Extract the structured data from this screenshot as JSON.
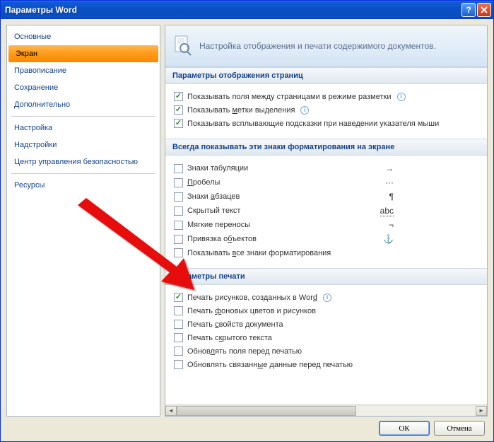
{
  "window": {
    "title": "Параметры Word"
  },
  "sidebar": {
    "items": [
      "Основные",
      "Экран",
      "Правописание",
      "Сохранение",
      "Дополнительно",
      "Настройка",
      "Надстройки",
      "Центр управления безопасностью",
      "Ресурсы"
    ],
    "selected_index": 1
  },
  "header": {
    "text": "Настройка отображения и печати содержимого документов."
  },
  "sections": {
    "display": {
      "title": "Параметры отображения страниц",
      "options": [
        {
          "label_html": "Показывать поля между страницами в режиме разметки",
          "checked": true,
          "info": true
        },
        {
          "label_html": "Показывать <u>м</u>етки выделения",
          "checked": true,
          "info": true
        },
        {
          "label_html": "Показывать всплывающие подсказки при наведении указателя мыши",
          "checked": true,
          "info": false
        }
      ]
    },
    "marks": {
      "title": "Всегда показывать эти знаки форматирования на экране",
      "options": [
        {
          "label_html": "Знаки табуляции",
          "checked": false,
          "symbol": "→"
        },
        {
          "label_html": "<u>П</u>робелы",
          "checked": false,
          "symbol": "···"
        },
        {
          "label_html": "Знаки <u>а</u>бзацев",
          "checked": false,
          "symbol": "¶"
        },
        {
          "label_html": "Скрытый текст",
          "checked": false,
          "symbol": "abc",
          "symbol_style": "dotted"
        },
        {
          "label_html": "Мягкие переносы",
          "checked": false,
          "symbol": "¬"
        },
        {
          "label_html": "Привязка о<u>б</u>ъектов",
          "checked": false,
          "symbol": "⚓"
        },
        {
          "label_html": "Показывать <u>в</u>се знаки форматирования",
          "checked": false,
          "symbol": ""
        }
      ]
    },
    "print": {
      "title": "Параметры печати",
      "options": [
        {
          "label_html": "Печать рисунков, созданных в Wor<u>d</u>",
          "checked": true,
          "info": true
        },
        {
          "label_html": "Печать <u>ф</u>оновых цветов и рисунков",
          "checked": false
        },
        {
          "label_html": "Печать <u>с</u>войств документа",
          "checked": false
        },
        {
          "label_html": "Печать с<u>к</u>рытого текста",
          "checked": false
        },
        {
          "label_html": "Обнов<u>л</u>ять поля перед печатью",
          "checked": false
        },
        {
          "label_html": "Обновлять связанн<u>ы</u>е данные перед печатью",
          "checked": false
        }
      ]
    }
  },
  "buttons": {
    "ok": "ОК",
    "cancel": "Отмена"
  }
}
